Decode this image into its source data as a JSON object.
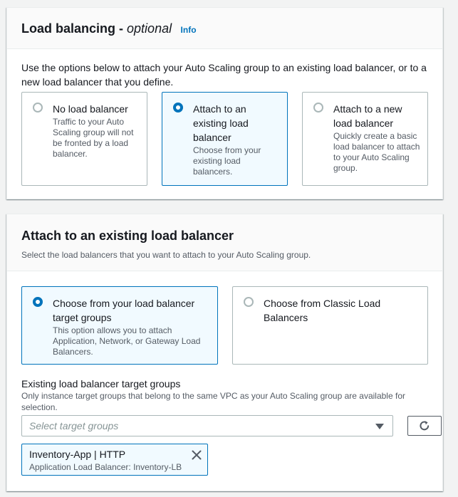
{
  "load_balancing": {
    "title": "Load balancing -",
    "title_optional": "optional",
    "info": "Info",
    "description": "Use the options below to attach your Auto Scaling group to an existing load balancer, or to a new load balancer that you define.",
    "options": [
      {
        "label": "No load balancer",
        "desc": "Traffic to your Auto Scaling group will not be fronted by a load balancer.",
        "selected": false
      },
      {
        "label": "Attach to an existing load balancer",
        "desc": "Choose from your existing load balancers.",
        "selected": true
      },
      {
        "label": "Attach to a new load balancer",
        "desc": "Quickly create a basic load balancer to attach to your Auto Scaling group.",
        "selected": false
      }
    ]
  },
  "attach_existing": {
    "title": "Attach to an existing load balancer",
    "description": "Select the load balancers that you want to attach to your Auto Scaling group.",
    "options": [
      {
        "label": "Choose from your load balancer target groups",
        "desc": "This option allows you to attach Application, Network, or Gateway Load Balancers.",
        "selected": true
      },
      {
        "label": "Choose from Classic Load Balancers",
        "desc": "",
        "selected": false
      }
    ],
    "target_groups": {
      "label": "Existing load balancer target groups",
      "description": "Only instance target groups that belong to the same VPC as your Auto Scaling group are available for selection.",
      "placeholder": "Select target groups",
      "selected_token": {
        "title": "Inventory-App | HTTP",
        "desc": "Application Load Balancer: Inventory-LB"
      }
    }
  },
  "colors": {
    "accent": "#0073bb",
    "selected_bg": "#f1faff",
    "border": "#aab7b8",
    "page_bg": "#f2f3f3"
  },
  "icons": {
    "refresh": "refresh-icon",
    "dropdown": "caret-down-icon",
    "dismiss": "close-icon"
  }
}
